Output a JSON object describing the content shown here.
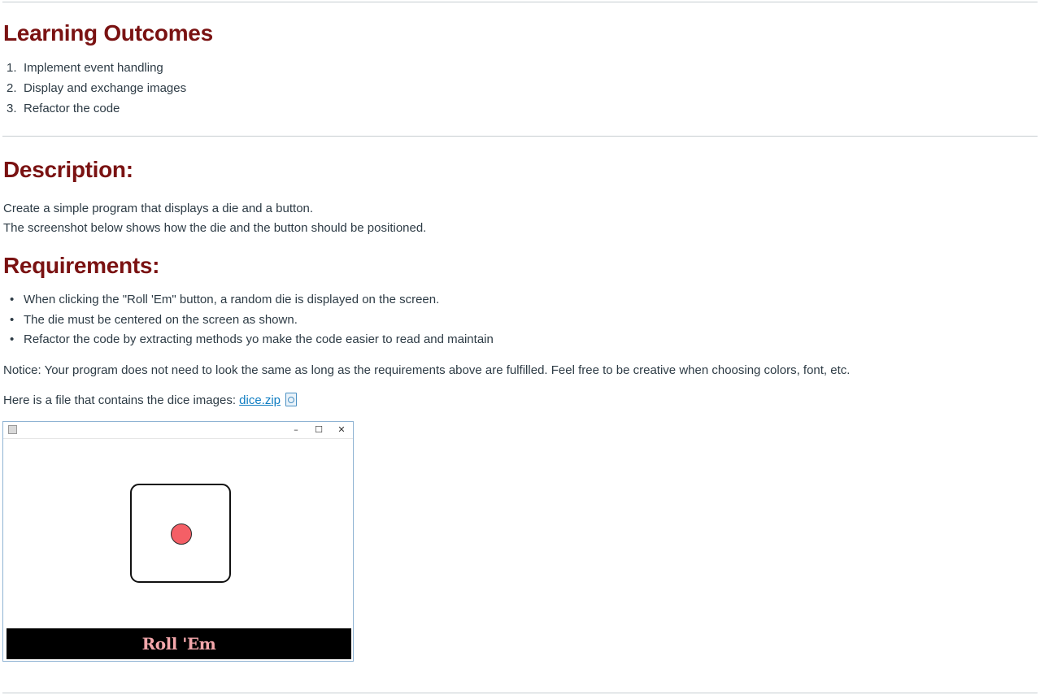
{
  "learning_outcomes": {
    "heading": "Learning Outcomes",
    "items": [
      {
        "num": "1.",
        "text": "Implement event handling"
      },
      {
        "num": "2.",
        "text": "Display and exchange images"
      },
      {
        "num": "3.",
        "text": "Refactor the code"
      }
    ]
  },
  "description": {
    "heading": "Description:",
    "lines": [
      "Create a simple program that displays a die and a button.",
      "The screenshot below shows how the die and the button should be positioned."
    ]
  },
  "requirements": {
    "heading": "Requirements:",
    "items": [
      "When clicking the \"Roll 'Em\" button, a random die is displayed on the screen.",
      "The die must be centered on the screen as shown.",
      "Refactor the code by extracting methods yo make the code easier to read and maintain"
    ]
  },
  "notice": "Notice: Your program does not need to look the same as long as the requirements above are fulfilled. Feel free to be creative when choosing colors, font, etc.",
  "file_line": {
    "prefix": "Here is a file that contains the dice images: ",
    "link_text": "dice.zip",
    "preview_icon": "document-preview-icon"
  },
  "app_window": {
    "app_icon": "java-app-icon",
    "minimize_glyph": "–",
    "maximize_glyph": "☐",
    "close_glyph": "✕",
    "die_face": 1,
    "pip_color": "#f45f66",
    "button_label": "Roll 'Em",
    "button_bg": "#000000",
    "button_text_color": "#f4a7ab"
  },
  "colors": {
    "heading": "#7a1212",
    "link": "#0f7dc2",
    "text": "#2d3b45",
    "divider": "#c7cdd1"
  }
}
